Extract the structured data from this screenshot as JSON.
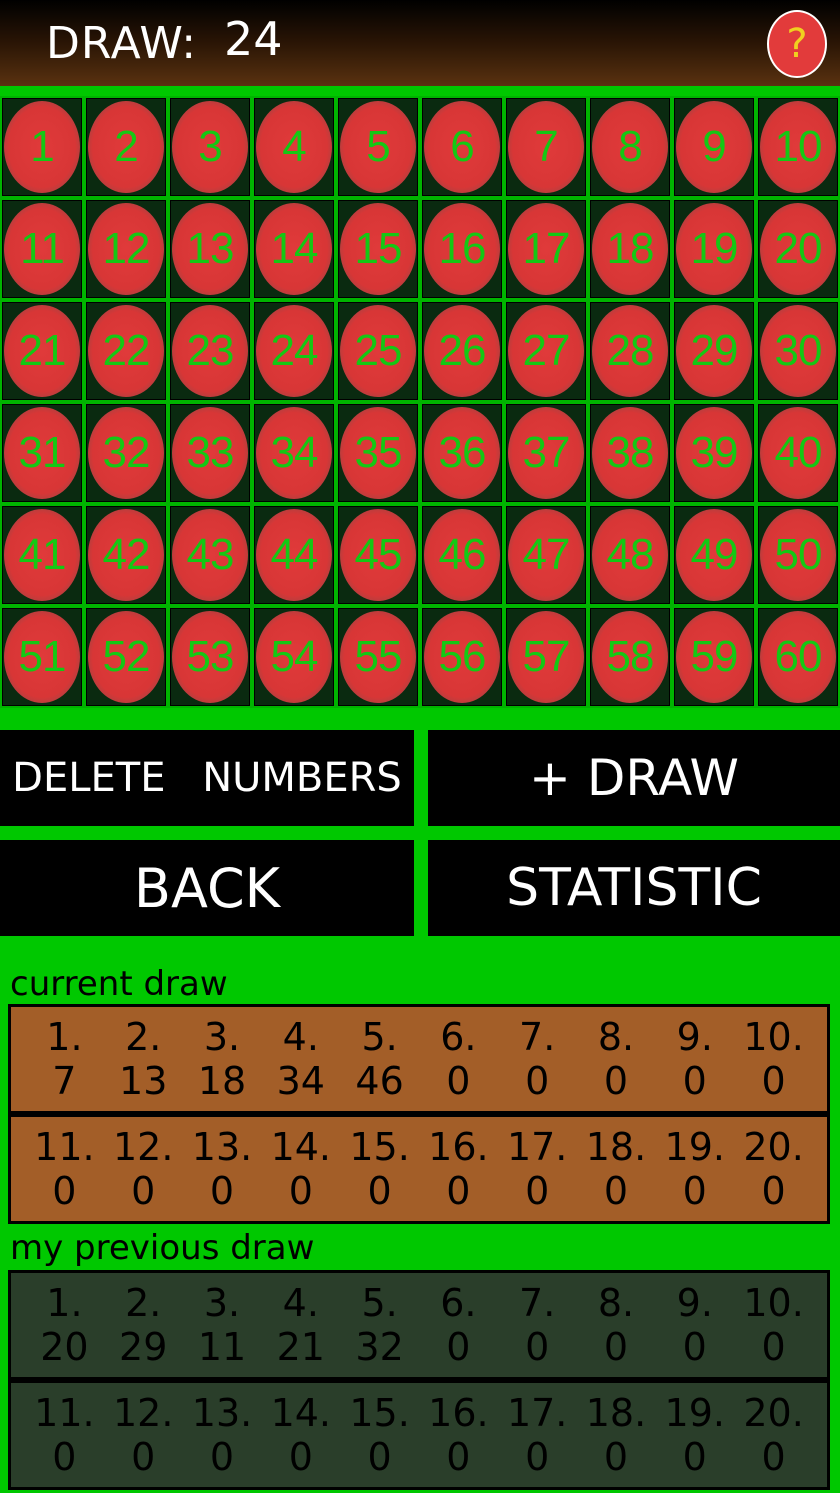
{
  "header": {
    "draw_label": "DRAW:",
    "draw_count": "24",
    "help_label": "?"
  },
  "colors": {
    "background": "#00c800",
    "ball_fill": "#e03a3a",
    "ball_text": "#14c814",
    "current_panel": "#a35e28",
    "previous_panel": "#2a3e2a"
  },
  "grid": {
    "numbers": [
      "1",
      "2",
      "3",
      "4",
      "5",
      "6",
      "7",
      "8",
      "9",
      "10",
      "11",
      "12",
      "13",
      "14",
      "15",
      "16",
      "17",
      "18",
      "19",
      "20",
      "21",
      "22",
      "23",
      "24",
      "25",
      "26",
      "27",
      "28",
      "29",
      "30",
      "31",
      "32",
      "33",
      "34",
      "35",
      "36",
      "37",
      "38",
      "39",
      "40",
      "41",
      "42",
      "43",
      "44",
      "45",
      "46",
      "47",
      "48",
      "49",
      "50",
      "51",
      "52",
      "53",
      "54",
      "55",
      "56",
      "57",
      "58",
      "59",
      "60"
    ]
  },
  "buttons": {
    "delete": "DELETE NUMBERS",
    "draw": "+ DRAW",
    "back": "BACK",
    "statistic": "STATISTIC"
  },
  "current_draw": {
    "label": "current draw",
    "positions": [
      "1.",
      "2.",
      "3.",
      "4.",
      "5.",
      "6.",
      "7.",
      "8.",
      "9.",
      "10.",
      "11.",
      "12.",
      "13.",
      "14.",
      "15.",
      "16.",
      "17.",
      "18.",
      "19.",
      "20."
    ],
    "values": [
      "7",
      "13",
      "18",
      "34",
      "46",
      "0",
      "0",
      "0",
      "0",
      "0",
      "0",
      "0",
      "0",
      "0",
      "0",
      "0",
      "0",
      "0",
      "0",
      "0"
    ]
  },
  "previous_draw": {
    "label": "my previous draw",
    "positions": [
      "1.",
      "2.",
      "3.",
      "4.",
      "5.",
      "6.",
      "7.",
      "8.",
      "9.",
      "10.",
      "11.",
      "12.",
      "13.",
      "14.",
      "15.",
      "16.",
      "17.",
      "18.",
      "19.",
      "20."
    ],
    "values": [
      "20",
      "29",
      "11",
      "21",
      "32",
      "0",
      "0",
      "0",
      "0",
      "0",
      "0",
      "0",
      "0",
      "0",
      "0",
      "0",
      "0",
      "0",
      "0",
      "0"
    ]
  }
}
